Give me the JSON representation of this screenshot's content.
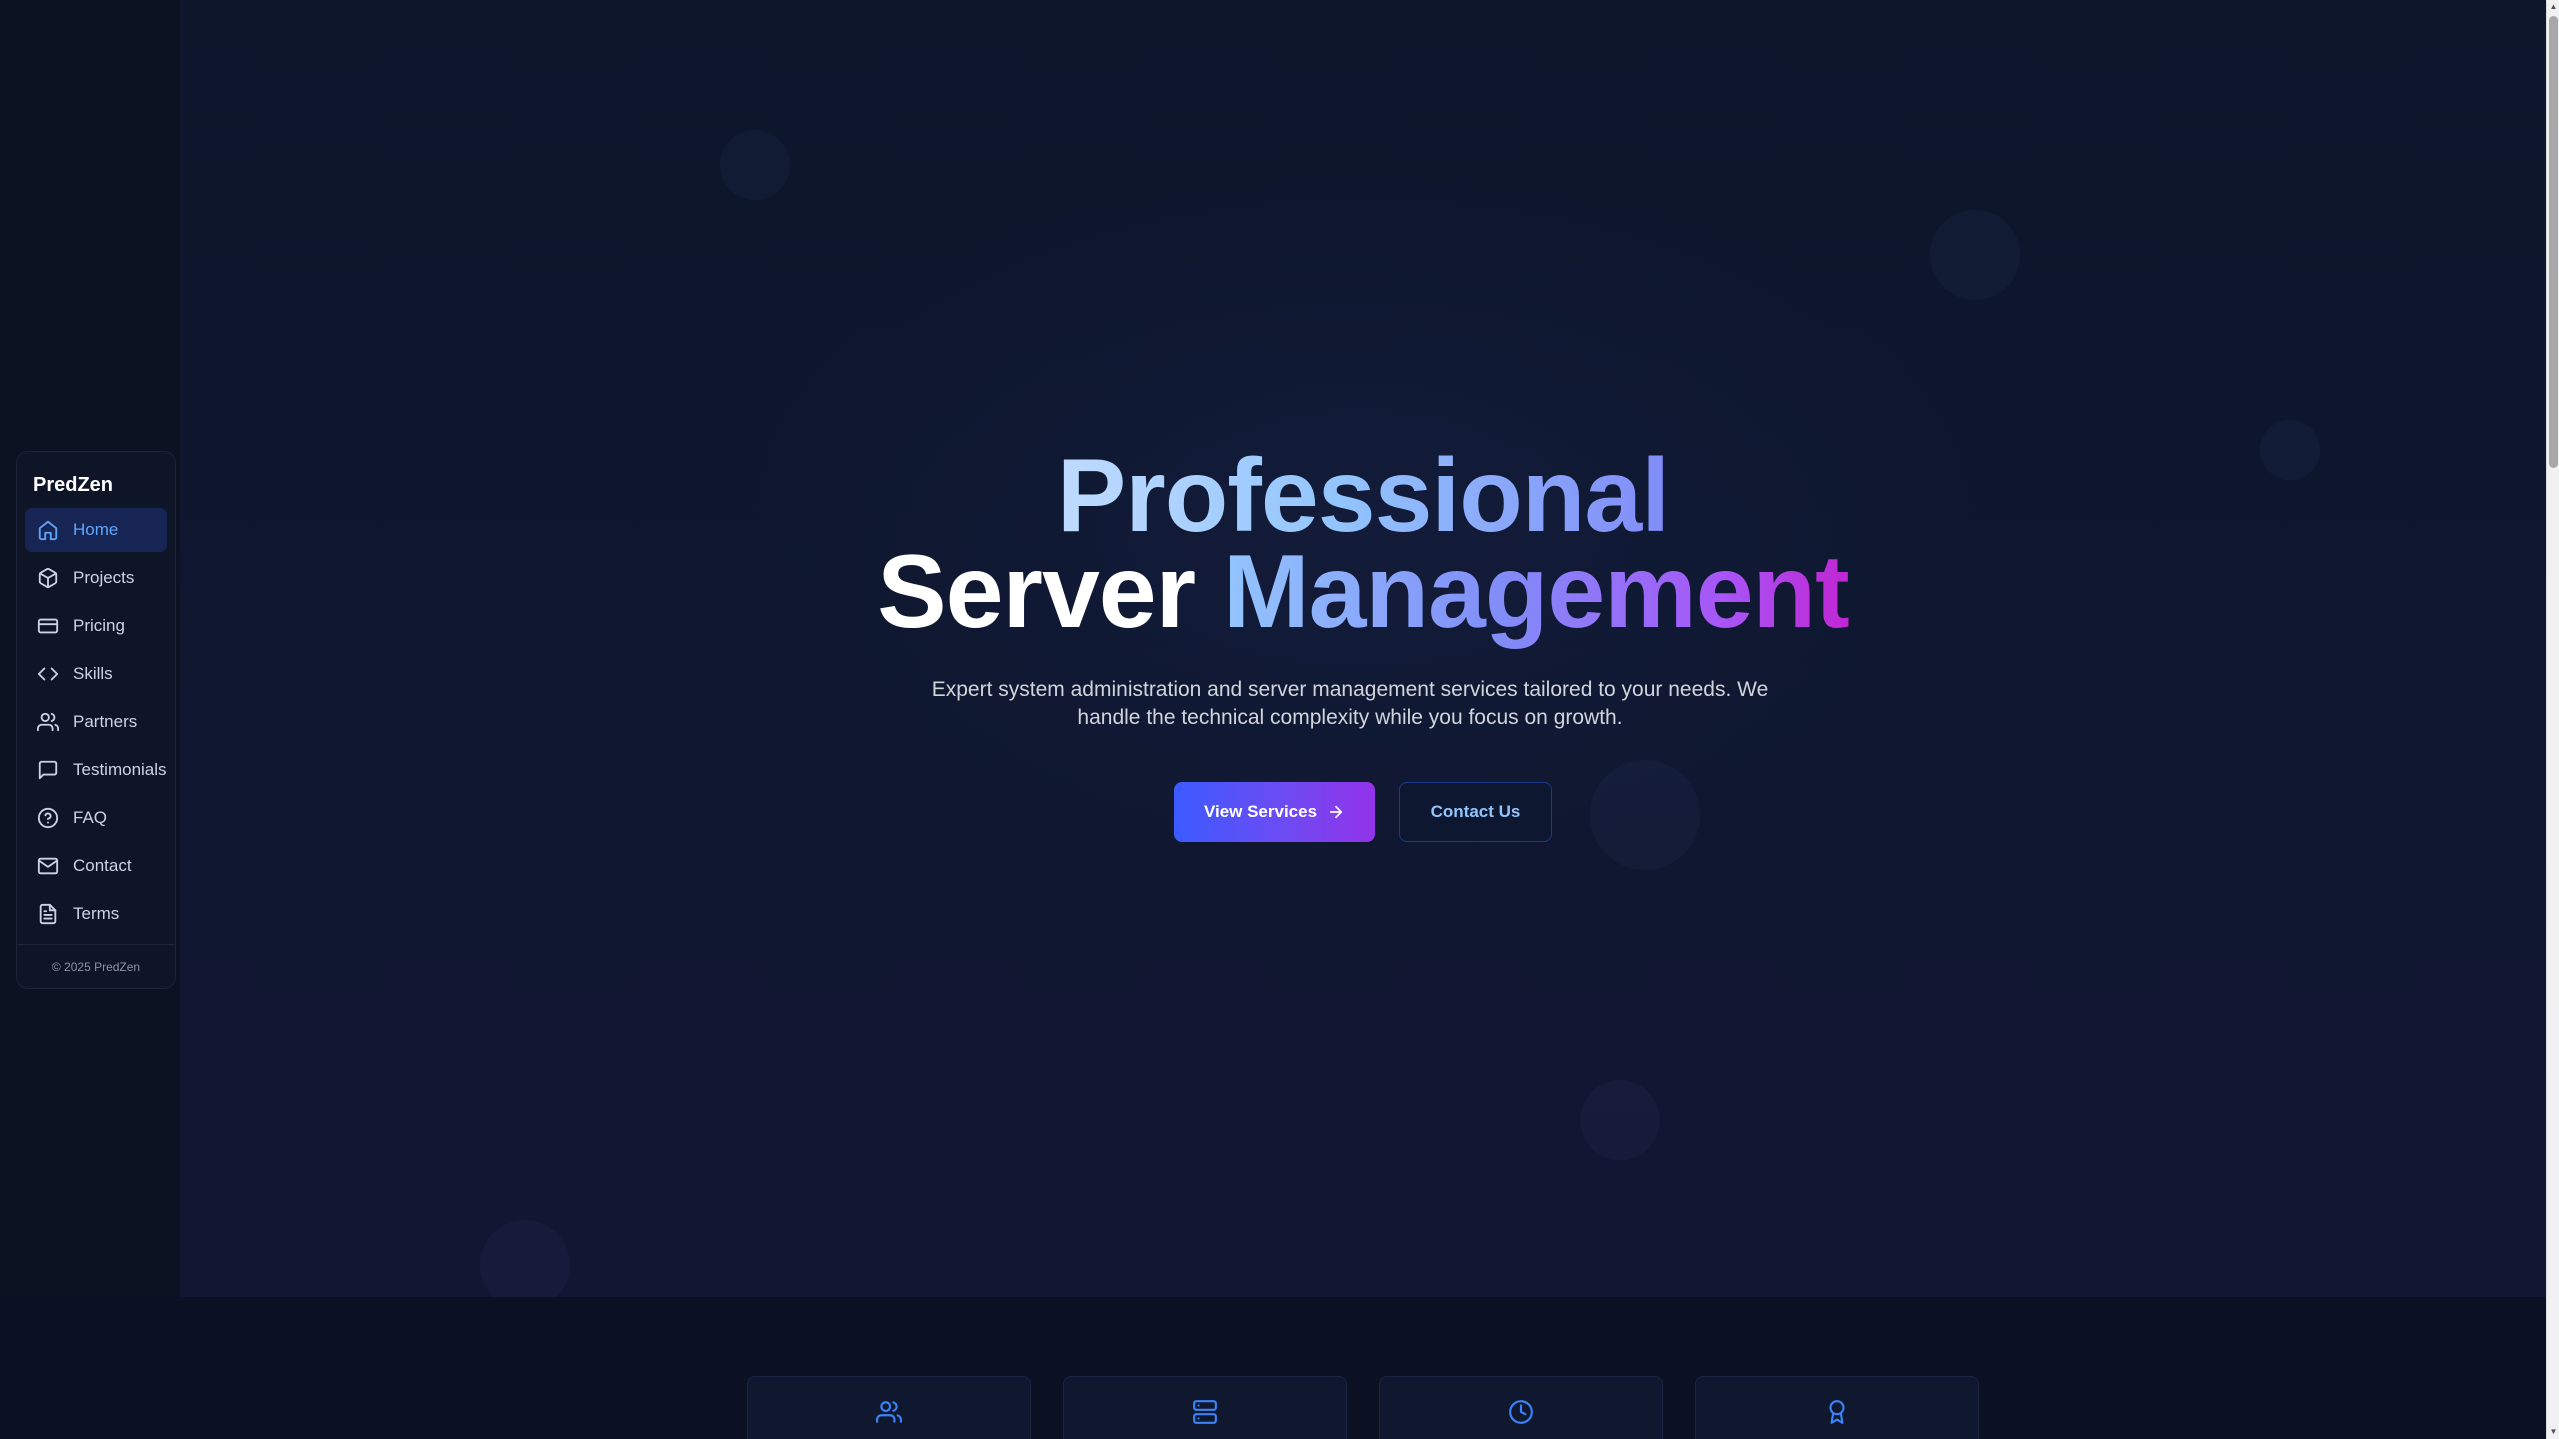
{
  "sidebar": {
    "brand": "PredZen",
    "items": [
      {
        "label": "Home",
        "icon": "home-icon",
        "active": true
      },
      {
        "label": "Projects",
        "icon": "box-icon",
        "active": false
      },
      {
        "label": "Pricing",
        "icon": "credit-card-icon",
        "active": false
      },
      {
        "label": "Skills",
        "icon": "code-icon",
        "active": false
      },
      {
        "label": "Partners",
        "icon": "users-icon",
        "active": false
      },
      {
        "label": "Testimonials",
        "icon": "message-square-icon",
        "active": false
      },
      {
        "label": "FAQ",
        "icon": "help-circle-icon",
        "active": false
      },
      {
        "label": "Contact",
        "icon": "mail-icon",
        "active": false
      },
      {
        "label": "Terms",
        "icon": "file-text-icon",
        "active": false
      }
    ],
    "footer": "© 2025 PredZen"
  },
  "hero": {
    "title_line1": "Professional",
    "title_line2_a": "Server ",
    "title_line2_b": "Management",
    "subtitle": "Expert system administration and server management services tailored to your needs. We handle the technical complexity while you focus on growth.",
    "primary_button": "View Services",
    "secondary_button": "Contact Us"
  },
  "features": [
    {
      "icon": "users-icon"
    },
    {
      "icon": "server-icon"
    },
    {
      "icon": "clock-icon"
    },
    {
      "icon": "award-icon"
    }
  ],
  "colors": {
    "background": "#0b1122",
    "accent": "#60a5fa",
    "active_nav_bg": "#172554",
    "gradient_start": "#3b5bff",
    "gradient_end": "#9333ea"
  }
}
